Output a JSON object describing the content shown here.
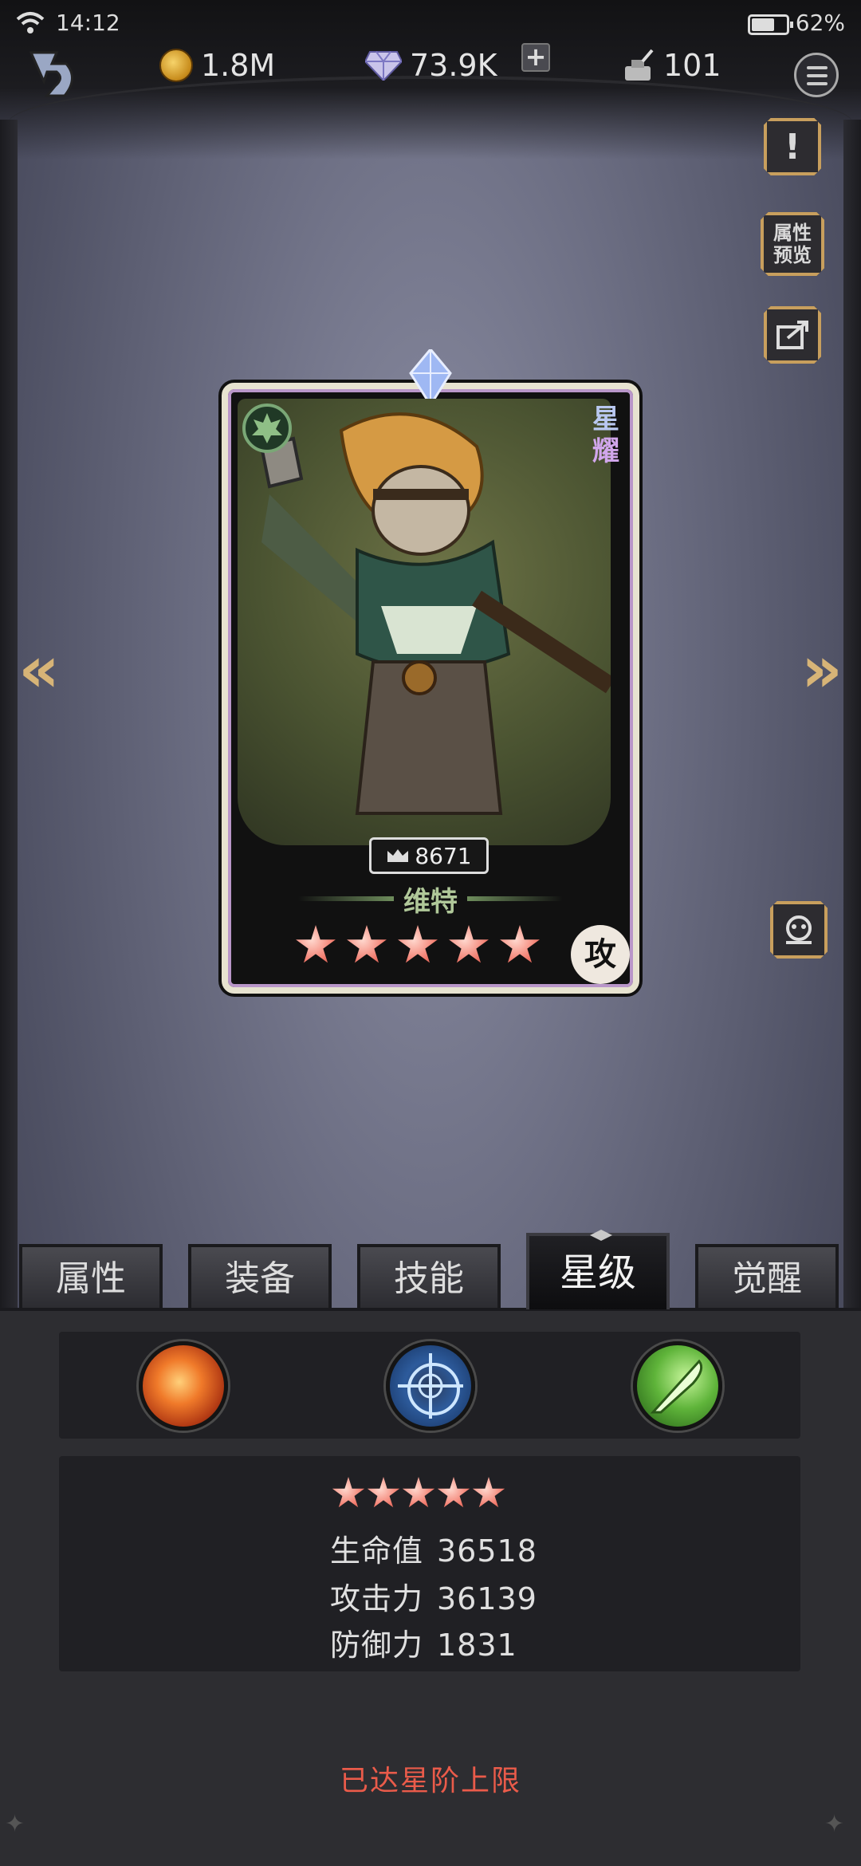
{
  "status_bar": {
    "time": "14:12",
    "battery_pct": "62%"
  },
  "currency": {
    "gold": "1.8M",
    "gems": "73.9K",
    "plus_label": "+",
    "ink": "101"
  },
  "side_buttons": {
    "alert_label": "!",
    "attr_preview_line1": "属性",
    "attr_preview_line2": "预览"
  },
  "card": {
    "rarity_tag_line1": "星",
    "rarity_tag_line2": "耀",
    "power": "8671",
    "hero_name": "维特",
    "stars": 5,
    "role": "攻"
  },
  "tabs": [
    {
      "label": "属性"
    },
    {
      "label": "装备"
    },
    {
      "label": "技能"
    },
    {
      "label": "星级"
    },
    {
      "label": "觉醒"
    }
  ],
  "active_tab": "星级",
  "skills": [
    {
      "icon": "fire-swirl-icon"
    },
    {
      "icon": "crosshair-icon"
    },
    {
      "icon": "green-blade-icon"
    }
  ],
  "stats": {
    "stars": 5,
    "hp_label": "生命值",
    "hp_value": "36518",
    "atk_label": "攻击力",
    "atk_value": "36139",
    "def_label": "防御力",
    "def_value": "1831"
  },
  "max_message": "已达星阶上限",
  "colors": {
    "accent_gold": "#c89f5d",
    "warning_red": "#ea5b4a"
  }
}
